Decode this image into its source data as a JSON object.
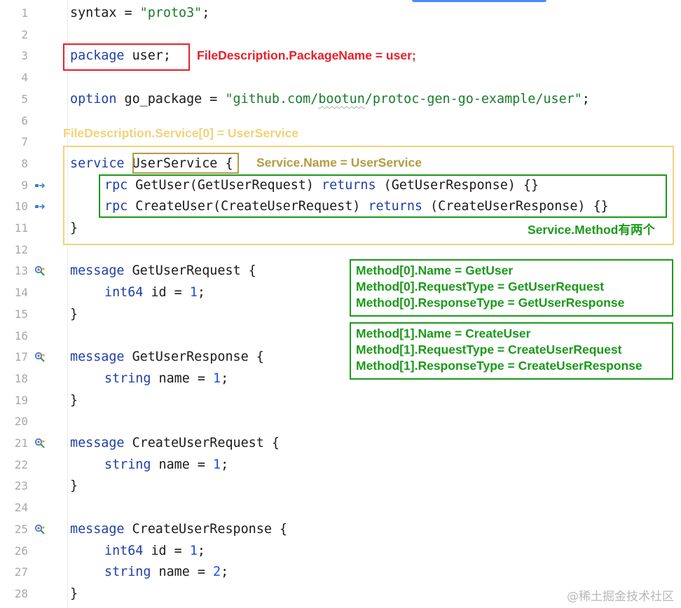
{
  "editor": {
    "lines": [
      {
        "n": "1",
        "segments": [
          {
            "t": "syntax = ",
            "c": ""
          },
          {
            "t": "\"proto3\"",
            "c": "str"
          },
          {
            "t": ";",
            "c": ""
          }
        ]
      },
      {
        "n": "2",
        "segments": []
      },
      {
        "n": "3",
        "segments": [
          {
            "t": "package",
            "c": "kw"
          },
          {
            "t": " user;",
            "c": ""
          }
        ]
      },
      {
        "n": "4",
        "segments": []
      },
      {
        "n": "5",
        "segments": [
          {
            "t": "option",
            "c": "kw"
          },
          {
            "t": " go_package = ",
            "c": ""
          },
          {
            "t": "\"github.com/",
            "c": "str"
          },
          {
            "t": "bootun",
            "c": "str sq"
          },
          {
            "t": "/protoc-gen-go-example/user\"",
            "c": "str"
          },
          {
            "t": ";",
            "c": ""
          }
        ]
      },
      {
        "n": "6",
        "segments": []
      },
      {
        "n": "7",
        "segments": []
      },
      {
        "n": "8",
        "segments": [
          {
            "t": "service",
            "c": "kw"
          },
          {
            "t": " UserService { ",
            "c": ""
          }
        ]
      },
      {
        "n": "9",
        "icon": "implements-icon",
        "indent": true,
        "segments": [
          {
            "t": "rpc",
            "c": "kw"
          },
          {
            "t": " GetUser(GetUserRequest) ",
            "c": ""
          },
          {
            "t": "returns",
            "c": "kw"
          },
          {
            "t": " (GetUserResponse) {}",
            "c": ""
          }
        ]
      },
      {
        "n": "10",
        "icon": "implements-icon",
        "indent": true,
        "segments": [
          {
            "t": "rpc",
            "c": "kw"
          },
          {
            "t": " CreateUser(CreateUserRequest) ",
            "c": ""
          },
          {
            "t": "returns",
            "c": "kw"
          },
          {
            "t": " (CreateUserResponse) {}",
            "c": ""
          }
        ]
      },
      {
        "n": "11",
        "segments": [
          {
            "t": "}",
            "c": ""
          }
        ]
      },
      {
        "n": "12",
        "segments": []
      },
      {
        "n": "13",
        "icon": "message-icon",
        "segments": [
          {
            "t": "message",
            "c": "kw"
          },
          {
            "t": " GetUserRequest {",
            "c": ""
          }
        ]
      },
      {
        "n": "14",
        "indent": true,
        "segments": [
          {
            "t": "int64",
            "c": "kw"
          },
          {
            "t": " id = ",
            "c": ""
          },
          {
            "t": "1",
            "c": "num"
          },
          {
            "t": ";",
            "c": ""
          }
        ]
      },
      {
        "n": "15",
        "segments": [
          {
            "t": "}",
            "c": ""
          }
        ]
      },
      {
        "n": "16",
        "segments": []
      },
      {
        "n": "17",
        "icon": "message-icon",
        "segments": [
          {
            "t": "message",
            "c": "kw"
          },
          {
            "t": " GetUserResponse {",
            "c": ""
          }
        ]
      },
      {
        "n": "18",
        "indent": true,
        "segments": [
          {
            "t": "string",
            "c": "kw"
          },
          {
            "t": " name = ",
            "c": ""
          },
          {
            "t": "1",
            "c": "num"
          },
          {
            "t": ";",
            "c": ""
          }
        ]
      },
      {
        "n": "19",
        "segments": [
          {
            "t": "}",
            "c": ""
          }
        ]
      },
      {
        "n": "20",
        "segments": []
      },
      {
        "n": "21",
        "icon": "message-icon",
        "segments": [
          {
            "t": "message",
            "c": "kw"
          },
          {
            "t": " CreateUserRequest {",
            "c": ""
          }
        ]
      },
      {
        "n": "22",
        "indent": true,
        "segments": [
          {
            "t": "string",
            "c": "kw"
          },
          {
            "t": " name = ",
            "c": ""
          },
          {
            "t": "1",
            "c": "num"
          },
          {
            "t": ";",
            "c": ""
          }
        ]
      },
      {
        "n": "23",
        "segments": [
          {
            "t": "}",
            "c": ""
          }
        ]
      },
      {
        "n": "24",
        "segments": []
      },
      {
        "n": "25",
        "icon": "message-icon",
        "segments": [
          {
            "t": "message",
            "c": "kw"
          },
          {
            "t": " CreateUserResponse {",
            "c": ""
          }
        ]
      },
      {
        "n": "26",
        "indent": true,
        "segments": [
          {
            "t": "int64",
            "c": "kw"
          },
          {
            "t": " id = ",
            "c": ""
          },
          {
            "t": "1",
            "c": "num"
          },
          {
            "t": ";",
            "c": ""
          }
        ]
      },
      {
        "n": "27",
        "indent": true,
        "segments": [
          {
            "t": "string",
            "c": "kw"
          },
          {
            "t": " name = ",
            "c": ""
          },
          {
            "t": "2",
            "c": "num"
          },
          {
            "t": ";",
            "c": ""
          }
        ]
      },
      {
        "n": "28",
        "segments": [
          {
            "t": "}",
            "c": ""
          }
        ]
      }
    ]
  },
  "annotations": {
    "package_name": "FileDescription.PackageName = user;",
    "service_index": "FileDescription.Service[0] = UserService",
    "service_name": "Service.Name = UserService",
    "method_count": "Service.Method有两个",
    "method0": [
      "Method[0].Name = GetUser",
      "Method[0].RequestType = GetUserRequest",
      "Method[0].ResponseType = GetUserResponse"
    ],
    "method1": [
      "Method[1].Name = CreateUser",
      "Method[1].RequestType = CreateUserRequest",
      "Method[1].ResponseType = CreateUserResponse"
    ]
  },
  "watermark": "@稀土掘金技术社区",
  "colors": {
    "keyword": "#1f3fa8",
    "string": "#1b7a2c",
    "number": "#1750eb",
    "red": "#e8202a",
    "gold": "#f1d37a",
    "olive": "#b39a44",
    "green": "#1a9a1a"
  }
}
